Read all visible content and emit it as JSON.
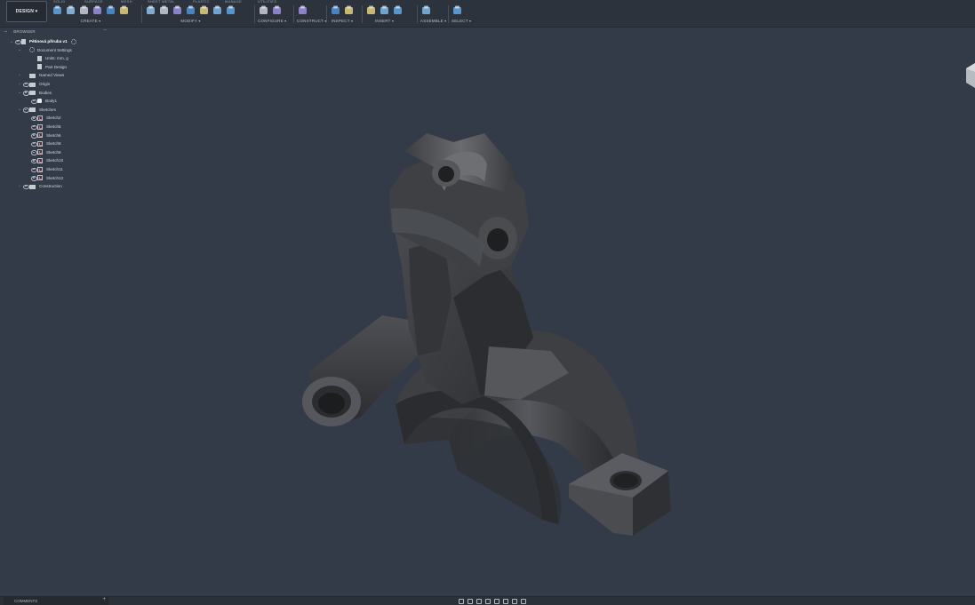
{
  "toolbar": {
    "workspace": "DESIGN",
    "tabs": [
      "SOLID",
      "SURFACE",
      "MESH",
      "SHEET METAL",
      "PLASTIC",
      "MANAGE",
      "UTILITIES"
    ],
    "groups": [
      {
        "label": "CREATE",
        "icons": [
          "new-sketch-icon",
          "extrude-icon",
          "revolve-icon",
          "box-icon",
          "pattern-icon",
          "form-icon"
        ]
      },
      {
        "label": "MODIFY",
        "icons": [
          "press-pull-icon",
          "fillet-icon",
          "shell-icon",
          "combine-icon",
          "offset-face-icon",
          "move-icon",
          "align-icon"
        ]
      },
      {
        "label": "CONFIGURE",
        "icons": [
          "configure-table-icon",
          "configure-rule-icon"
        ]
      },
      {
        "label": "CONSTRUCT",
        "icons": [
          "offset-plane-icon"
        ]
      },
      {
        "label": "INSPECT",
        "icons": [
          "measure-icon",
          "interference-icon"
        ]
      },
      {
        "label": "INSERT",
        "icons": [
          "insert-derive-icon",
          "insert-image-icon",
          "insert-mcmaster-icon"
        ]
      },
      {
        "label": "ASSEMBLE",
        "icons": [
          "joint-icon"
        ]
      },
      {
        "label": "SELECT",
        "icons": [
          "select-icon"
        ]
      }
    ]
  },
  "browser": {
    "title": "BROWSER",
    "tree": [
      {
        "label": "Pětinová příruba v1",
        "indent": 0,
        "arrow": "down",
        "eye": true,
        "icon": "document"
      },
      {
        "label": "Document Settings",
        "indent": 1,
        "arrow": "down",
        "eye": false,
        "icon": "gear"
      },
      {
        "label": "Units: mm, g",
        "indent": 2,
        "arrow": "",
        "eye": false,
        "icon": "document"
      },
      {
        "label": "Part Design",
        "indent": 2,
        "arrow": "",
        "eye": false,
        "icon": "document"
      },
      {
        "label": "Named Views",
        "indent": 1,
        "arrow": "right",
        "eye": false,
        "icon": "folder"
      },
      {
        "label": "Origin",
        "indent": 1,
        "arrow": "right",
        "eye": true,
        "icon": "folder"
      },
      {
        "label": "Bodies",
        "indent": 1,
        "arrow": "down",
        "eye": true,
        "icon": "folder"
      },
      {
        "label": "Body1",
        "indent": 2,
        "arrow": "",
        "eye": true,
        "icon": "body"
      },
      {
        "label": "Sketches",
        "indent": 1,
        "arrow": "down",
        "eye": true,
        "icon": "folder"
      },
      {
        "label": "Sketch2",
        "indent": 2,
        "arrow": "",
        "eye": true,
        "icon": "sketch"
      },
      {
        "label": "Sketch5",
        "indent": 2,
        "arrow": "",
        "eye": true,
        "icon": "sketch"
      },
      {
        "label": "Sketch6",
        "indent": 2,
        "arrow": "",
        "eye": true,
        "icon": "sketch"
      },
      {
        "label": "Sketch8",
        "indent": 2,
        "arrow": "",
        "eye": true,
        "icon": "sketch"
      },
      {
        "label": "Sketch9",
        "indent": 2,
        "arrow": "",
        "eye": true,
        "icon": "sketch"
      },
      {
        "label": "Sketch10",
        "indent": 2,
        "arrow": "",
        "eye": true,
        "icon": "sketch"
      },
      {
        "label": "Sketch11",
        "indent": 2,
        "arrow": "",
        "eye": true,
        "icon": "sketch"
      },
      {
        "label": "Sketch12",
        "indent": 2,
        "arrow": "",
        "eye": true,
        "icon": "sketch"
      },
      {
        "label": "Construction",
        "indent": 1,
        "arrow": "right",
        "eye": true,
        "icon": "folder"
      }
    ]
  },
  "bottom": {
    "comments": "COMMENTS",
    "nav_tools": [
      "orbit-icon",
      "pan-icon",
      "look-at-icon",
      "zoom-icon",
      "fit-icon",
      "display-settings-icon",
      "grid-icon",
      "viewports-icon"
    ]
  },
  "colors": {
    "background": "#333b48",
    "toolbar": "#2d333d",
    "model": "#3a3c40"
  }
}
